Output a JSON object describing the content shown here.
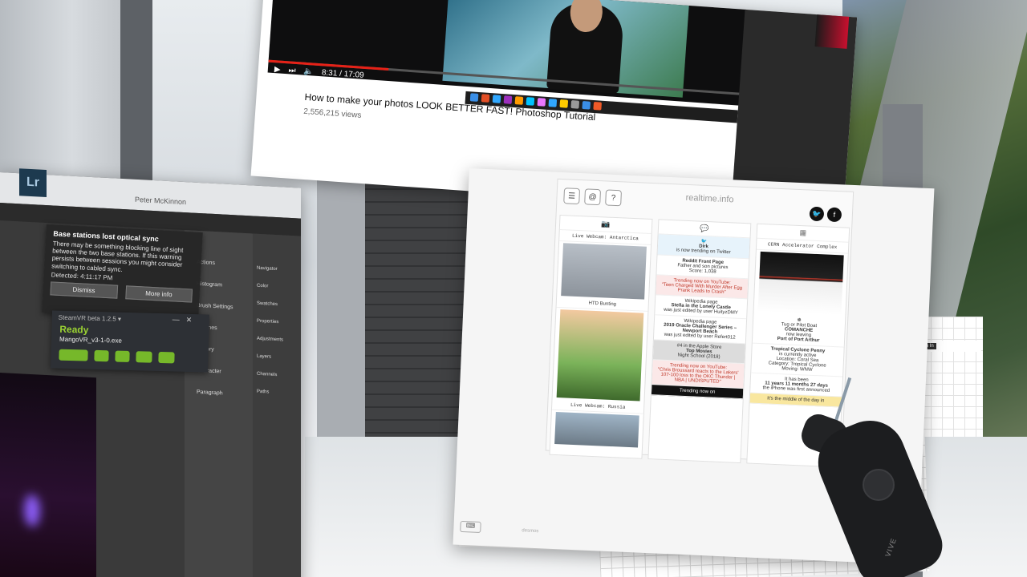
{
  "youtube": {
    "time": "8:31 / 17:09",
    "title": "How to make your photos LOOK BETTER FAST! Photoshop Tutorial",
    "views": "2,556,215 views"
  },
  "photoshop": {
    "app_icon": "Lr",
    "user": "Peter McKinnon",
    "panels_left": [
      "Actions",
      "Histogram",
      "Brush Settings",
      "Brushes",
      "History",
      "Character",
      "Paragraph"
    ],
    "panels_right": [
      "Navigator",
      "Color",
      "Swatches",
      "Properties",
      "Adjustments",
      "Layers",
      "Channels",
      "Paths"
    ]
  },
  "notification": {
    "title": "Base stations lost optical sync",
    "body": "There may be something blocking line of sight between the two base stations. If this warning persists between sessions you might consider switching to cabled sync.",
    "detected": "Detected: 4:11:17 PM",
    "dismiss": "Dismiss",
    "more_info": "More info"
  },
  "steamvr": {
    "title": "SteamVR beta 1.2.5 ▾",
    "status": "Ready",
    "file": "MangoVR_v3-1-0.exe",
    "minimize": "—",
    "close": "✕"
  },
  "realtime": {
    "title": "realtime.info",
    "twitter_icon": "🐦",
    "facebook_icon": "f",
    "col1": {
      "webcam1": "Live Webcam: Antarctica",
      "webcam1_caption": "HTD Bunting",
      "webcam2": "Live Webcam: Russia"
    },
    "col2": {
      "trend_user": "Dirk",
      "trend_text": "is now trending on Twitter",
      "reddit": "Reddit Front Page",
      "reddit_sub": "Father and son pictures",
      "reddit_meta": "Score: 1,038",
      "yt_trend": "Trending now on YouTube:",
      "yt_trend_title": "\"Teen Charged With Murder After Egg Prank Leads to Crash\"",
      "wiki1": "Wikipedia page",
      "wiki1_title": "Stella in the Lonely Castle",
      "wiki1_meta": "was just edited by user HuityzDMY",
      "wiki2": "Wikipedia page",
      "wiki2_title": "2019 Oracle Challenger Series – Newport Beach",
      "wiki2_meta": "was just edited by user Refert012",
      "apple_rank": "#4 in the Apple Store",
      "apple_cat": "Top Movies",
      "apple_title": "Night School (2018)",
      "yt_trend2": "Trending now on YouTube:",
      "yt_trend2_title": "\"Chris Broussard reacts to the Lakers' 107-100 loss to the OKC Thunder | NBA | UNDISPUTED\"",
      "bottom": "Trending now on"
    },
    "col3": {
      "cern": "CERN Accelerator Complex",
      "tug": "Tug or Pilot Boat",
      "boat_name": "COMANCHE",
      "boat_status": "now leaving",
      "port": "Port of Port Arthur",
      "cyclone": "Tropical Cyclone Penny",
      "cyclone_status": "is currently active",
      "cyclone_location": "Location:",
      "cyclone_location_val": "Coral Sea",
      "cyclone_category": "Category:",
      "cyclone_category_val": "Tropical Cyclone",
      "cyclone_moving": "Moving:",
      "cyclone_moving_val": "WNW",
      "time_ago": "11 years 11 months 27 days",
      "time_text": "the iPhone was first announced",
      "middle": "It's the middle of the day in",
      "ago_label": "It has been"
    },
    "keyboard": "⌨",
    "footer": "desmos"
  },
  "desmos_bar": {
    "signin": "Sign In"
  },
  "controller": {
    "brand": "VIVE"
  },
  "colors": {
    "ready": "#9cd433",
    "progress": "#e62117"
  }
}
